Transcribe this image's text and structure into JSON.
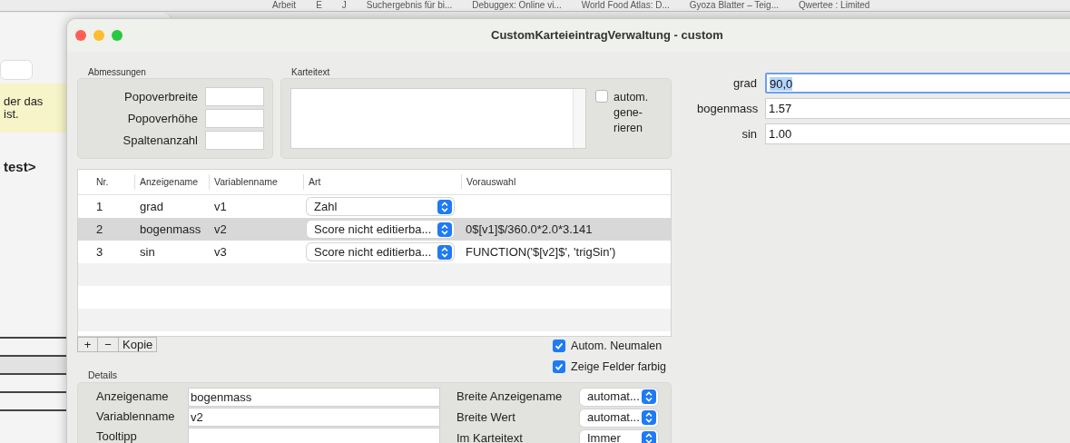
{
  "bookmarks": [
    {
      "label": "Arbeit"
    },
    {
      "label": "E"
    },
    {
      "label": "J"
    },
    {
      "label": "Suchergebnis für bi..."
    },
    {
      "label": "Debuggex: Online vi..."
    },
    {
      "label": "World Food Atlas: D..."
    },
    {
      "label": "Gyoza Blatter – Teig..."
    },
    {
      "label": "Qwertee : Limited"
    }
  ],
  "background_window": {
    "notice": [
      "der das",
      "ist."
    ],
    "heading": "test>"
  },
  "window": {
    "title": "CustomKarteieintragVerwaltung - custom"
  },
  "dimensions": {
    "title": "Abmessungen",
    "fields": [
      {
        "label": "Popoverbreite"
      },
      {
        "label": "Popoverhöhe"
      },
      {
        "label": "Spaltenanzahl"
      }
    ]
  },
  "card_text": {
    "title": "Karteitext",
    "auto_generate": {
      "lines": [
        "autom.",
        "gene-",
        "rieren"
      ],
      "checked": false
    }
  },
  "table": {
    "columns": [
      "Nr.",
      "Anzeigename",
      "Variablenname",
      "Art",
      "Vorauswahl"
    ],
    "rows": [
      {
        "nr": "1",
        "name": "grad",
        "variable": "v1",
        "art": "Zahl",
        "preset": "",
        "selected": false
      },
      {
        "nr": "2",
        "name": "bogenmass",
        "variable": "v2",
        "art": "Score nicht editierba...",
        "preset": "0$[v1]$/360.0*2.0*3.141",
        "selected": true
      },
      {
        "nr": "3",
        "name": "sin",
        "variable": "v3",
        "art": "Score nicht editierba...",
        "preset": "FUNCTION('$[v2]$', 'trigSin')",
        "selected": false
      }
    ]
  },
  "table_buttons": [
    {
      "kind": "add",
      "label": "+"
    },
    {
      "kind": "remove",
      "label": "−"
    },
    {
      "kind": "copy",
      "label": "Kopie"
    }
  ],
  "options": [
    {
      "label": "Autom. Neumalen",
      "checked": true
    },
    {
      "label": "Zeige Felder farbig",
      "checked": true
    }
  ],
  "details": {
    "title": "Details",
    "fields": [
      {
        "label": "Anzeigename",
        "value": "bogenmass"
      },
      {
        "label": "Variablenname",
        "value": "v2"
      },
      {
        "label": "Tooltipp"
      }
    ],
    "settings": [
      {
        "label": "Breite Anzeigename",
        "value": "automat..."
      },
      {
        "label": "Breite Wert",
        "value": "automat..."
      },
      {
        "label": "Im Karteitext",
        "value": "Immer"
      }
    ]
  },
  "preview": [
    {
      "label": "grad",
      "value": "90,0",
      "focused": true
    },
    {
      "label": "bogenmass",
      "value": "1.57",
      "focused": false
    },
    {
      "label": "sin",
      "value": "1.00",
      "focused": false
    }
  ]
}
